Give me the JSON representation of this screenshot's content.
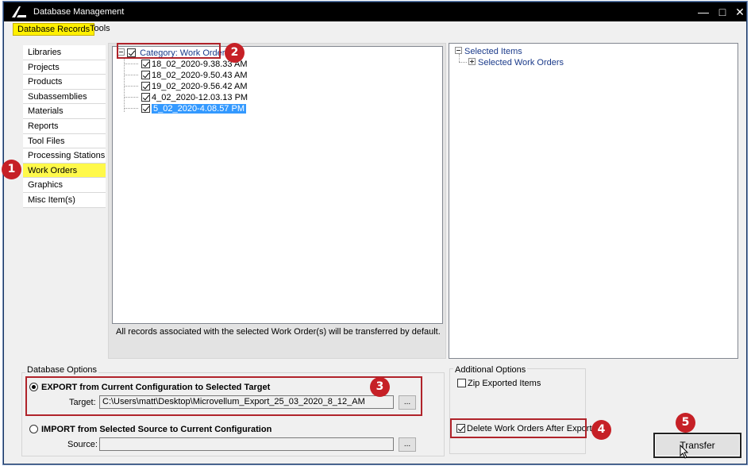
{
  "window": {
    "title": "Database Management",
    "controls": [
      "—",
      "□",
      "✕"
    ]
  },
  "menu_tabs": [
    {
      "label": "Database Records",
      "active": true
    },
    {
      "label": "Tools",
      "active": false
    }
  ],
  "sidebar": {
    "items": [
      {
        "label": "Libraries"
      },
      {
        "label": "Projects"
      },
      {
        "label": "Products"
      },
      {
        "label": "Subassemblies"
      },
      {
        "label": "Materials"
      },
      {
        "label": "Reports"
      },
      {
        "label": "Tool Files"
      },
      {
        "label": "Processing Stations"
      },
      {
        "label": "Work Orders",
        "selected": true
      },
      {
        "label": "Graphics"
      },
      {
        "label": "Misc Item(s)"
      }
    ]
  },
  "records_tree": {
    "category_label": "Category: Work Orders",
    "items": [
      {
        "label": "18_02_2020-9.38.33 AM",
        "checked": true
      },
      {
        "label": "18_02_2020-9.50.43 AM",
        "checked": true
      },
      {
        "label": "19_02_2020-9.56.42 AM",
        "checked": true
      },
      {
        "label": "4_02_2020-12.03.13 PM",
        "checked": true
      },
      {
        "label": "5_02_2020-4.08.57 PM",
        "checked": true,
        "highlighted": true
      }
    ],
    "note": "All records associated with the selected Work Order(s) will be transferred by default."
  },
  "selected_tree": {
    "root_label": "Selected Items",
    "child_label": "Selected Work Orders"
  },
  "database_options": {
    "group_label": "Database Options",
    "export_label": "EXPORT from Current Configuration to Selected Target",
    "export_selected": true,
    "target_label": "Target:",
    "target_value": "C:\\Users\\matt\\Desktop\\Microvellum_Export_25_03_2020_8_12_AM",
    "import_label": "IMPORT from Selected Source to Current Configuration",
    "import_selected": false,
    "source_label": "Source:",
    "source_value": "",
    "browse_label": "..."
  },
  "additional_options": {
    "group_label": "Additional Options",
    "zip_label": "Zip Exported Items",
    "zip_checked": false,
    "delete_label": "Delete Work Orders After Export",
    "delete_checked": true
  },
  "transfer_label": "Transfer",
  "callouts": [
    "1",
    "2",
    "3",
    "4",
    "5"
  ],
  "colors": {
    "highlight_yellow": "#fff94a",
    "callout_red": "#c62026",
    "selection_blue": "#3399ff"
  }
}
